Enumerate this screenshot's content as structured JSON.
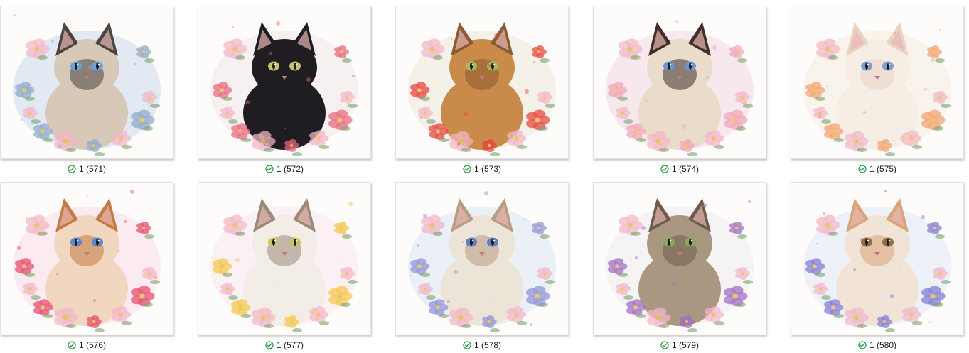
{
  "files": [
    {
      "name": "1 (571)",
      "status_icon": "synced-check-icon",
      "cat": "ragdoll-blue-eyes",
      "flower_color": "#8fa9c9",
      "fur_color": "#d8c8b8",
      "face_color": "#4b4440",
      "eye_color": "#6f9fd8",
      "bg_wash": "#dfe7f1"
    },
    {
      "name": "1 (572)",
      "status_icon": "synced-check-icon",
      "cat": "black-cat",
      "flower_color": "#e9667c",
      "fur_color": "#1f1d22",
      "face_color": "#1f1d22",
      "eye_color": "#c9c26a",
      "bg_wash": "#f5eef0"
    },
    {
      "name": "1 (573)",
      "status_icon": "synced-check-icon",
      "cat": "bengal-tabby",
      "flower_color": "#e8423c",
      "fur_color": "#c98a4a",
      "face_color": "#8a5a32",
      "eye_color": "#a8b860",
      "bg_wash": "#f2efe6"
    },
    {
      "name": "1 (574)",
      "status_icon": "synced-check-icon",
      "cat": "siamese",
      "flower_color": "#f2a4b8",
      "fur_color": "#e9dccb",
      "face_color": "#3f2f2a",
      "eye_color": "#6a94d6",
      "bg_wash": "#f6e6ec"
    },
    {
      "name": "1 (575)",
      "status_icon": "synced-check-icon",
      "cat": "cream-kitten",
      "flower_color": "#f2a070",
      "fur_color": "#f6eee4",
      "face_color": "#e9d4c4",
      "eye_color": "#7d9fd0",
      "bg_wash": "#f7f3ea"
    },
    {
      "name": "1 (576)",
      "status_icon": "synced-check-icon",
      "cat": "orange-kitten",
      "flower_color": "#e64a6a",
      "fur_color": "#f1d7bf",
      "face_color": "#c47a45",
      "eye_color": "#5b86c9",
      "bg_wash": "#fbe8ee"
    },
    {
      "name": "1 (577)",
      "status_icon": "synced-check-icon",
      "cat": "calico-cat",
      "flower_color": "#f4c54a",
      "fur_color": "#f2ede6",
      "face_color": "#9a8a78",
      "eye_color": "#c8c466",
      "bg_wash": "#fbeef2"
    },
    {
      "name": "1 (578)",
      "status_icon": "synced-check-icon",
      "cat": "fluffy-kitten",
      "flower_color": "#8f92d6",
      "fur_color": "#ede4d8",
      "face_color": "#b79d83",
      "eye_color": "#5f7fc4",
      "bg_wash": "#e9edf5"
    },
    {
      "name": "1 (579)",
      "status_icon": "synced-check-icon",
      "cat": "tabby-cat",
      "flower_color": "#a06bc2",
      "fur_color": "#a99782",
      "face_color": "#6e5c4b",
      "eye_color": "#8aa85a",
      "bg_wash": "#f4f2f3"
    },
    {
      "name": "1 (580)",
      "status_icon": "synced-check-icon",
      "cat": "persian-cat",
      "flower_color": "#7f7ad1",
      "fur_color": "#f1e4d6",
      "face_color": "#d9a47a",
      "eye_color": "#8c6f4a",
      "bg_wash": "#edf0f8"
    }
  ],
  "colors": {
    "status_green": "#2e9b47",
    "caption_text": "#1a1a1a",
    "tile_border": "#e2e2e2"
  }
}
